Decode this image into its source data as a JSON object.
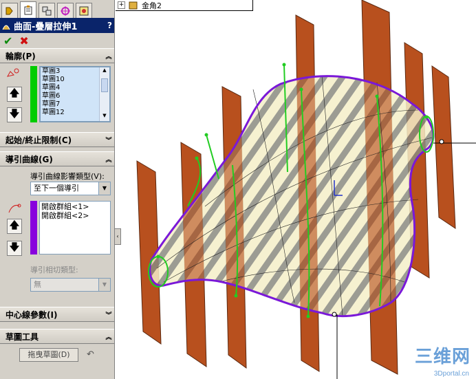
{
  "feature": {
    "title": "曲面-疊層拉伸1",
    "help": "?"
  },
  "tabs": [
    {
      "icon": "feature-manager-icon"
    },
    {
      "icon": "property-manager-icon"
    },
    {
      "icon": "configuration-manager-icon"
    },
    {
      "icon": "dimxpert-icon"
    },
    {
      "icon": "display-manager-icon"
    }
  ],
  "profiles": {
    "header": "輪廓(P)",
    "items": [
      "草圖3",
      "草圖10",
      "草圖4",
      "草圖6",
      "草圖7",
      "草圖12"
    ],
    "stripe_color": "#00cc00"
  },
  "start_end": {
    "header": "起始/終止限制(C)"
  },
  "guides": {
    "header": "導引曲線(G)",
    "influence_label": "導引曲線影響類型(V):",
    "influence_value": "至下一個導引",
    "items": [
      "開啟群組<1>",
      "開啟群組<2>"
    ],
    "stripe_color": "#8800dd",
    "tangency_label": "導引相切類型:",
    "tangency_value": "無"
  },
  "centerline": {
    "header": "中心線參數(I)"
  },
  "sketch_tools": {
    "header": "草圖工具",
    "drag_button": "拖曳草圖(D)"
  },
  "tree": {
    "node": "金角2"
  },
  "watermark": {
    "logo": "三维网",
    "url": "3Dportal.cn"
  },
  "colors": {
    "title_bar": "#0a246a",
    "plane": "#b8501e",
    "outline": "#7a18d8",
    "sketch": "#22cc22"
  }
}
